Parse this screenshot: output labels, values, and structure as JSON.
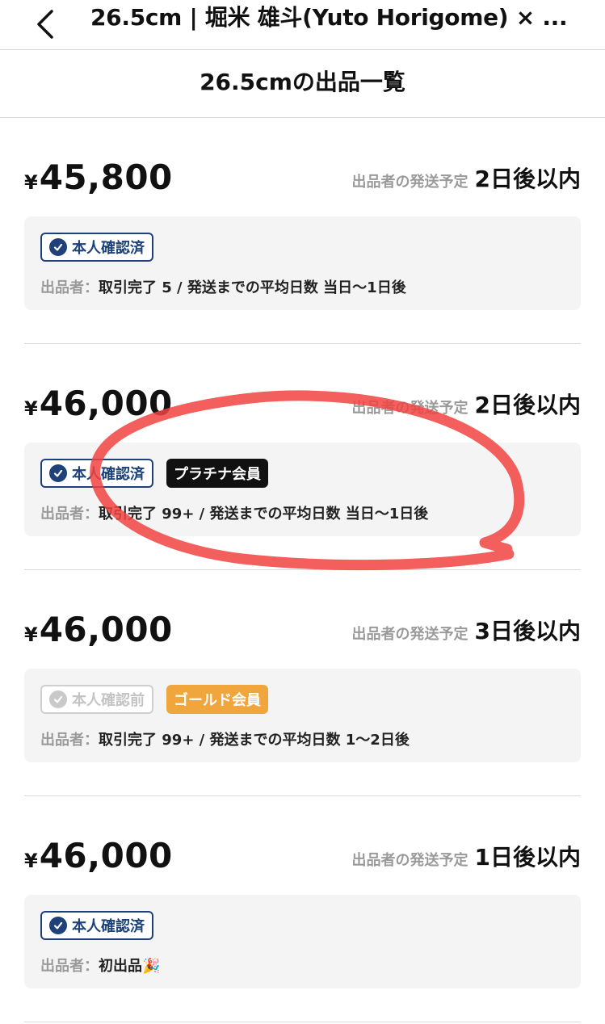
{
  "nav": {
    "title": "26.5cm | 堀米 雄斗(Yuto Horigome) × ...",
    "back_icon": "chevron-left-icon"
  },
  "subheader": {
    "title": "26.5cmの出品一覧"
  },
  "listing_common": {
    "currency_symbol": "¥",
    "ship_label": "出品者の発送予定",
    "seller_label": "出品者："
  },
  "listings": [
    {
      "price": "45,800",
      "ship_value": "2日後以内",
      "verify_label": "本人確認済",
      "verify_state": "verified",
      "seller_info": "取引完了 5 / 発送までの平均日数 当日〜1日後"
    },
    {
      "price": "46,000",
      "ship_value": "2日後以内",
      "verify_label": "本人確認済",
      "verify_state": "verified",
      "member_badge": "プラチナ会員",
      "member_type": "platinum",
      "seller_info": "取引完了 99+ / 発送までの平均日数 当日〜1日後"
    },
    {
      "price": "46,000",
      "ship_value": "3日後以内",
      "verify_label": "本人確認前",
      "verify_state": "pending",
      "member_badge": "ゴールド会員",
      "member_type": "gold",
      "seller_info": "取引完了 99+ / 発送までの平均日数 1〜2日後"
    },
    {
      "price": "46,000",
      "ship_value": "1日後以内",
      "verify_label": "本人確認済",
      "verify_state": "verified",
      "seller_info": "初出品🎉"
    }
  ],
  "colors": {
    "verified": "#1d4178",
    "platinum_bg": "#111111",
    "gold_bg": "#f0a63c",
    "annotation": "#f0433f"
  }
}
